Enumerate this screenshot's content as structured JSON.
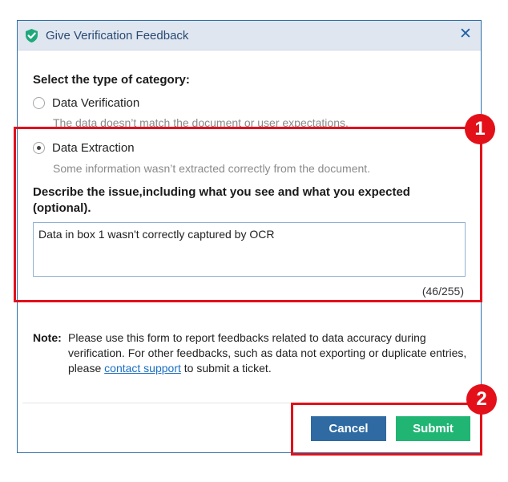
{
  "dialog": {
    "title": "Give Verification Feedback",
    "close_glyph": "✕"
  },
  "form": {
    "category_heading": "Select the type of category:",
    "options": [
      {
        "label": "Data Verification",
        "description": "The data doesn’t match the document or user expectations.",
        "selected": false
      },
      {
        "label": "Data Extraction",
        "description": "Some information wasn’t extracted correctly from the document.",
        "selected": true
      }
    ],
    "describe_label": "Describe the issue,including what you see and what you expected (optional).",
    "textarea_value": "Data in box 1 wasn't correctly captured by OCR",
    "char_counter": "(46/255)"
  },
  "note": {
    "label": "Note:",
    "text_before_link": "Please use this form to report feedbacks related to data accuracy during verification. For other feedbacks, such as data not exporting or duplicate entries, please ",
    "link_text": "contact support",
    "text_after_link": " to submit a ticket."
  },
  "buttons": {
    "cancel_label": "Cancel",
    "submit_label": "Submit"
  },
  "annotations": {
    "badge_1": "1",
    "badge_2": "2"
  },
  "colors": {
    "accent": "#2f6aa3",
    "submit": "#21b574",
    "highlight": "#e3101a",
    "link": "#1a6fc2"
  }
}
